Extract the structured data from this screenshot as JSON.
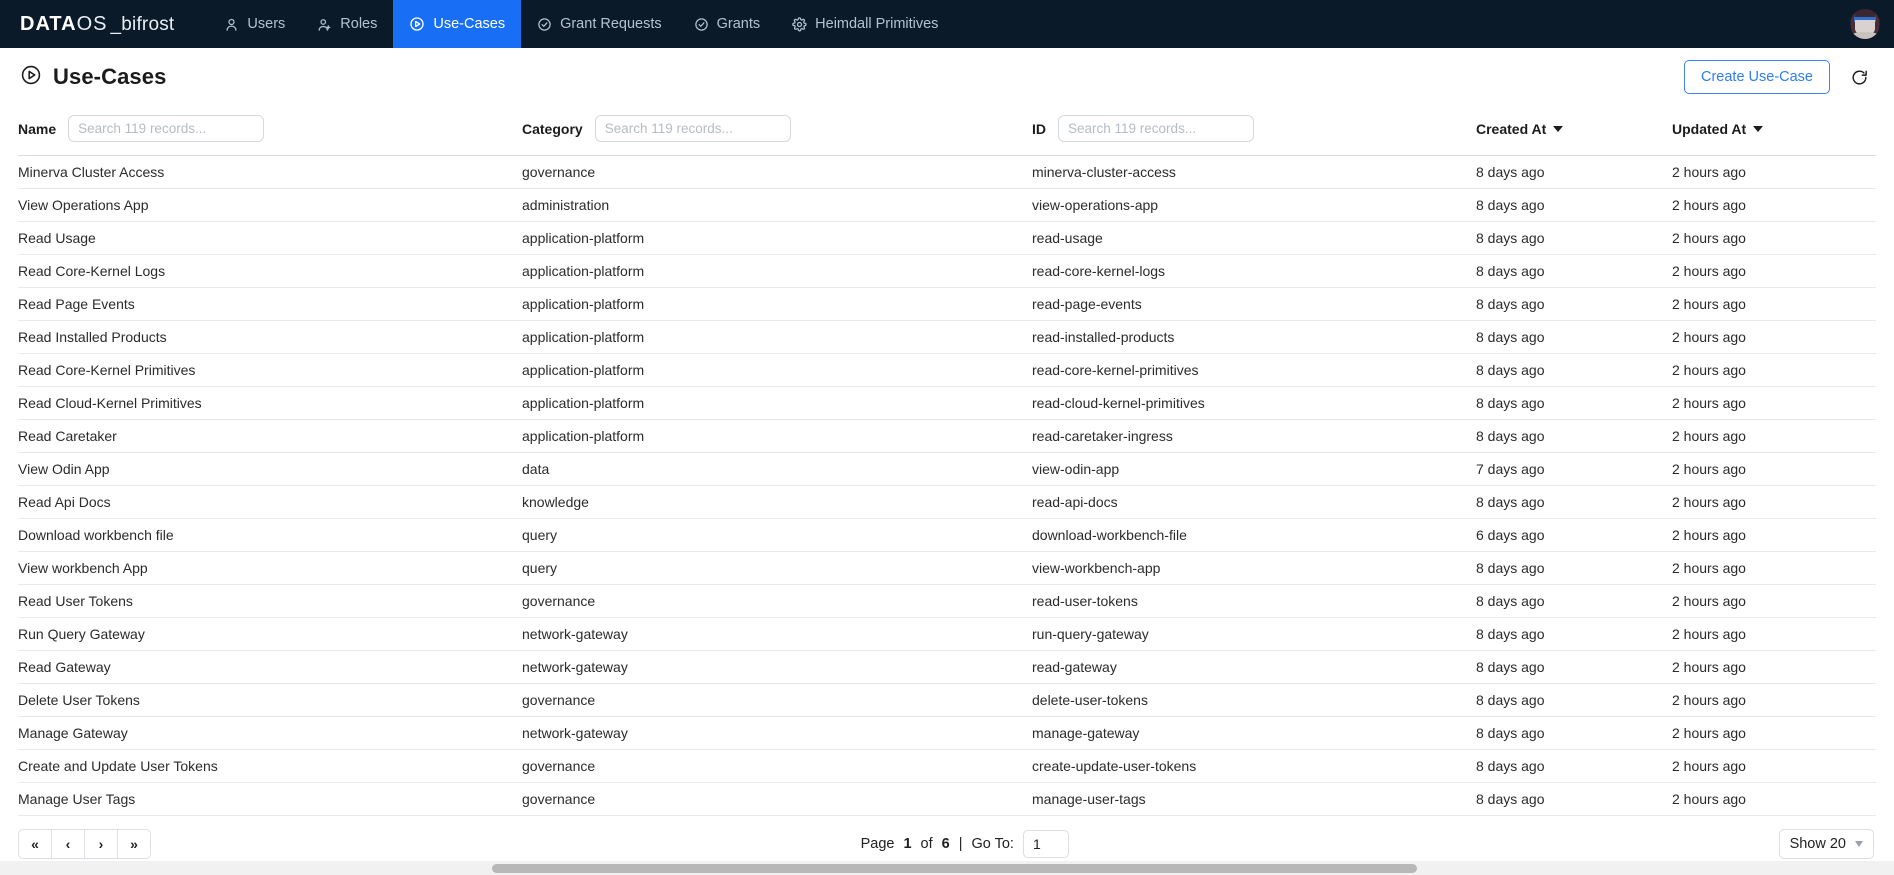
{
  "navbar": {
    "brand": {
      "part1": "DATA",
      "part2": "OS",
      "part3": "_bifrost"
    },
    "items": [
      {
        "label": "Users",
        "icon": "user-icon",
        "active": false
      },
      {
        "label": "Roles",
        "icon": "user-group-icon",
        "active": false
      },
      {
        "label": "Use-Cases",
        "icon": "play-circle-icon",
        "active": true
      },
      {
        "label": "Grant Requests",
        "icon": "check-circle-icon",
        "active": false
      },
      {
        "label": "Grants",
        "icon": "check-circle-icon",
        "active": false
      },
      {
        "label": "Heimdall Primitives",
        "icon": "gear-icon",
        "active": false
      }
    ],
    "avatar_alt": "user-avatar",
    "active_color": "#186ff6",
    "background_color": "#0b1a29"
  },
  "header": {
    "title": "Use-Cases",
    "title_icon": "play-circle-icon",
    "create_button": "Create Use-Case",
    "refresh_icon": "refresh-icon",
    "accent_color": "#2f7df5"
  },
  "table": {
    "columns": [
      {
        "label": "Name",
        "searchable": true,
        "sortable": false,
        "placeholder": "Search 119 records..."
      },
      {
        "label": "Category",
        "searchable": true,
        "sortable": false,
        "placeholder": "Search 119 records..."
      },
      {
        "label": "ID",
        "searchable": true,
        "sortable": false,
        "placeholder": "Search 119 records..."
      },
      {
        "label": "Created At",
        "searchable": false,
        "sortable": true,
        "placeholder": ""
      },
      {
        "label": "Updated At",
        "searchable": false,
        "sortable": true,
        "placeholder": ""
      }
    ],
    "rows": [
      {
        "name": "Minerva Cluster Access",
        "category": "governance",
        "id": "minerva-cluster-access",
        "created_at": "8 days ago",
        "updated_at": "2 hours ago"
      },
      {
        "name": "View Operations App",
        "category": "administration",
        "id": "view-operations-app",
        "created_at": "8 days ago",
        "updated_at": "2 hours ago"
      },
      {
        "name": "Read Usage",
        "category": "application-platform",
        "id": "read-usage",
        "created_at": "8 days ago",
        "updated_at": "2 hours ago"
      },
      {
        "name": "Read Core-Kernel Logs",
        "category": "application-platform",
        "id": "read-core-kernel-logs",
        "created_at": "8 days ago",
        "updated_at": "2 hours ago"
      },
      {
        "name": "Read Page Events",
        "category": "application-platform",
        "id": "read-page-events",
        "created_at": "8 days ago",
        "updated_at": "2 hours ago"
      },
      {
        "name": "Read Installed Products",
        "category": "application-platform",
        "id": "read-installed-products",
        "created_at": "8 days ago",
        "updated_at": "2 hours ago"
      },
      {
        "name": "Read Core-Kernel Primitives",
        "category": "application-platform",
        "id": "read-core-kernel-primitives",
        "created_at": "8 days ago",
        "updated_at": "2 hours ago"
      },
      {
        "name": "Read Cloud-Kernel Primitives",
        "category": "application-platform",
        "id": "read-cloud-kernel-primitives",
        "created_at": "8 days ago",
        "updated_at": "2 hours ago"
      },
      {
        "name": "Read Caretaker",
        "category": "application-platform",
        "id": "read-caretaker-ingress",
        "created_at": "8 days ago",
        "updated_at": "2 hours ago"
      },
      {
        "name": "View Odin App",
        "category": "data",
        "id": "view-odin-app",
        "created_at": "7 days ago",
        "updated_at": "2 hours ago"
      },
      {
        "name": "Read Api Docs",
        "category": "knowledge",
        "id": "read-api-docs",
        "created_at": "8 days ago",
        "updated_at": "2 hours ago"
      },
      {
        "name": "Download workbench file",
        "category": "query",
        "id": "download-workbench-file",
        "created_at": "6 days ago",
        "updated_at": "2 hours ago"
      },
      {
        "name": "View workbench App",
        "category": "query",
        "id": "view-workbench-app",
        "created_at": "8 days ago",
        "updated_at": "2 hours ago"
      },
      {
        "name": "Read User Tokens",
        "category": "governance",
        "id": "read-user-tokens",
        "created_at": "8 days ago",
        "updated_at": "2 hours ago"
      },
      {
        "name": "Run Query Gateway",
        "category": "network-gateway",
        "id": "run-query-gateway",
        "created_at": "8 days ago",
        "updated_at": "2 hours ago"
      },
      {
        "name": "Read Gateway",
        "category": "network-gateway",
        "id": "read-gateway",
        "created_at": "8 days ago",
        "updated_at": "2 hours ago"
      },
      {
        "name": "Delete User Tokens",
        "category": "governance",
        "id": "delete-user-tokens",
        "created_at": "8 days ago",
        "updated_at": "2 hours ago"
      },
      {
        "name": "Manage Gateway",
        "category": "network-gateway",
        "id": "manage-gateway",
        "created_at": "8 days ago",
        "updated_at": "2 hours ago"
      },
      {
        "name": "Create and Update User Tokens",
        "category": "governance",
        "id": "create-update-user-tokens",
        "created_at": "8 days ago",
        "updated_at": "2 hours ago"
      },
      {
        "name": "Manage User Tags",
        "category": "governance",
        "id": "manage-user-tags",
        "created_at": "8 days ago",
        "updated_at": "2 hours ago"
      }
    ]
  },
  "pagination": {
    "first_label": "«",
    "prev_label": "‹",
    "next_label": "›",
    "last_label": "»",
    "page_word": "Page",
    "current_page": "1",
    "of_word": "of",
    "total_pages": "6",
    "separator": "|",
    "goto_label": "Go To:",
    "goto_value": "1",
    "page_size_label": "Show 20"
  }
}
